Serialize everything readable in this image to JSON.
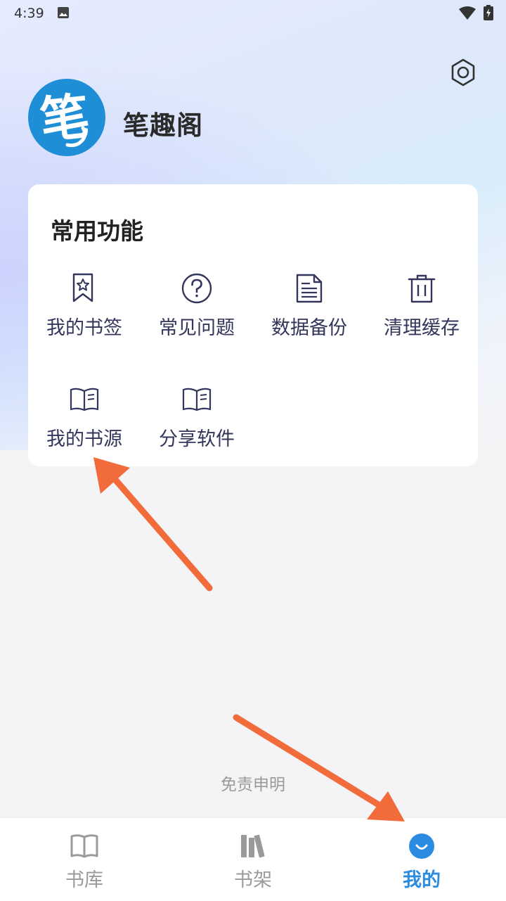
{
  "status_bar": {
    "time": "4:39"
  },
  "header": {
    "app_name": "笔趣阁",
    "avatar_char": "笔"
  },
  "functions_card": {
    "title": "常用功能",
    "items": [
      {
        "label": "我的书签",
        "icon": "bookmark-star-icon"
      },
      {
        "label": "常见问题",
        "icon": "question-circle-icon"
      },
      {
        "label": "数据备份",
        "icon": "document-icon"
      },
      {
        "label": "清理缓存",
        "icon": "trash-icon"
      },
      {
        "label": "我的书源",
        "icon": "open-book-icon"
      },
      {
        "label": "分享软件",
        "icon": "open-book-icon"
      }
    ]
  },
  "footer": {
    "disclaimer": "免责申明"
  },
  "bottom_nav": {
    "items": [
      {
        "label": "书库",
        "icon": "book-icon",
        "active": false
      },
      {
        "label": "书架",
        "icon": "bookshelf-icon",
        "active": false
      },
      {
        "label": "我的",
        "icon": "smile-icon",
        "active": true
      }
    ]
  },
  "colors": {
    "accent": "#2a8be0",
    "annotation_arrow": "#f26b3a",
    "avatar_bg": "#1e8fd6"
  }
}
